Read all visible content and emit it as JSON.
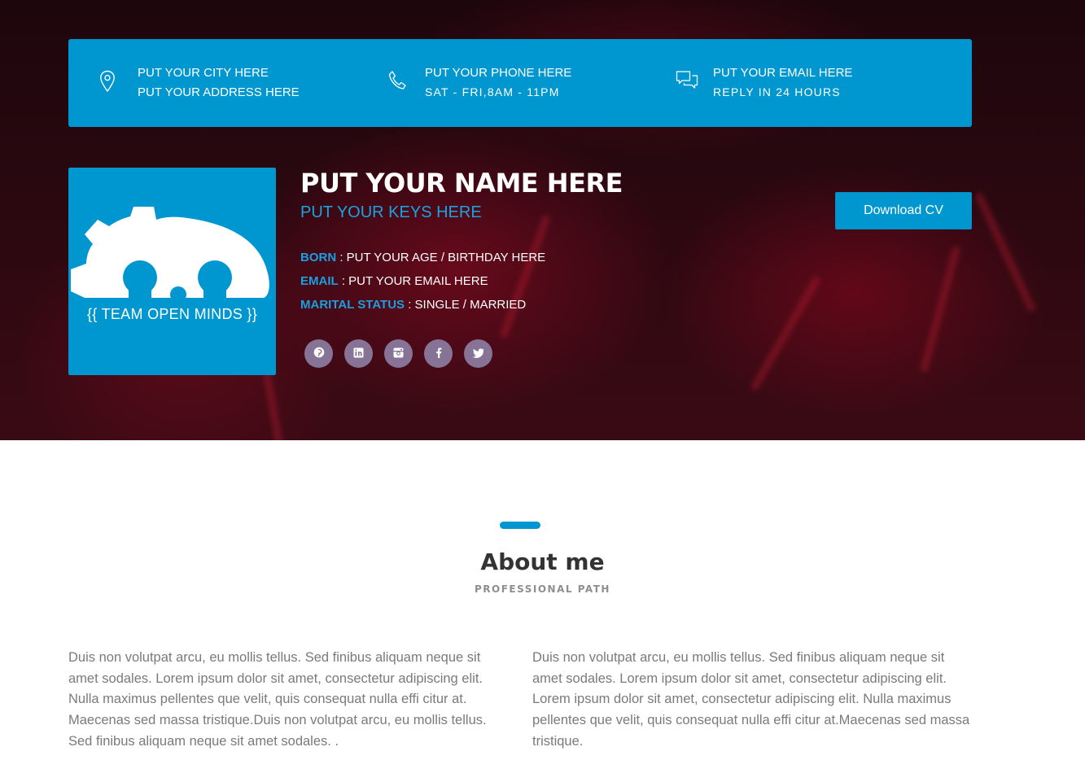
{
  "contact": {
    "city": "PUT YOUR CITY HERE",
    "address": "PUT YOUR ADDRESS HERE",
    "phone": "PUT YOUR PHONE HERE",
    "hours": "SAT - FRI,8AM - 11PM",
    "email": "PUT YOUR EMAIL HERE",
    "reply": "REPLY IN 24 HOURS",
    "icons": [
      "location-pin-icon",
      "phone-icon",
      "chat-bubbles-icon"
    ]
  },
  "profile": {
    "logo_text": "{{ TEAM OPEN MINDS }}",
    "name": "PUT YOUR NAME HERE",
    "keys": "PUT YOUR KEYS HERE",
    "born_label": "BORN",
    "born_value": " : PUT YOUR AGE / BIRTHDAY HERE",
    "email_label": "EMAIL",
    "email_value": " : PUT YOUR EMAIL HERE",
    "marital_label": "MARITAL STATUS",
    "marital_value": " : SINGLE / MARRIED",
    "socials": [
      "pinterest-icon",
      "linkedin-icon",
      "instagram-icon",
      "facebook-icon",
      "twitter-icon"
    ]
  },
  "actions": {
    "download_label": "Download CV"
  },
  "about": {
    "title": "About me",
    "subtitle": "PROFESSIONAL PATH",
    "col1": "Duis non volutpat arcu, eu mollis tellus. Sed finibus aliquam neque sit amet sodales. Lorem ipsum dolor sit amet, consectetur adipiscing elit. Nulla maximus pellentes que velit, quis consequat nulla effi citur at. Maecenas sed massa tristique.Duis non volutpat arcu, eu mollis tellus. Sed finibus aliquam neque sit amet sodales. .",
    "col2": "Duis non volutpat arcu, eu mollis tellus. Sed finibus aliquam neque sit amet sodales. Lorem ipsum dolor sit amet, consectetur adipiscing elit. Lorem ipsum dolor sit amet, consectetur adipiscing elit. Nulla maximus pellentes que velit, quis consequat nulla effi citur at.Maecenas sed massa tristique."
  },
  "colors": {
    "accent": "#0097d0",
    "social_bg": "#867396",
    "label_blue": "#1a9fe0",
    "hero_dark": "#2a0810"
  }
}
